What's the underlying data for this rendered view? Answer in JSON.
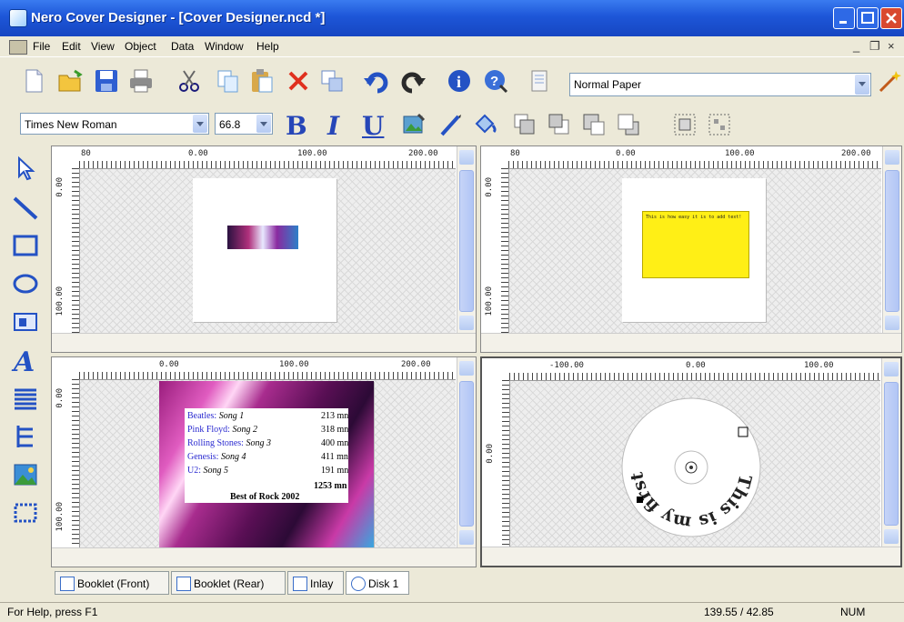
{
  "window": {
    "title": "Nero Cover Designer - [Cover Designer.ncd *]"
  },
  "menu": [
    "File",
    "Edit",
    "View",
    "Object",
    "Data",
    "Window",
    "Help"
  ],
  "mdi_controls": [
    "_",
    "❐",
    "×"
  ],
  "toolbar": {
    "paper_select": "Normal Paper"
  },
  "format_bar": {
    "font": "Times New Roman",
    "font_size": "66.8",
    "bold": "B",
    "italic": "I",
    "underline": "U"
  },
  "panes": {
    "booklet_front": {
      "h_ruler": [
        "80",
        "0.00",
        "100.00",
        "200.00"
      ],
      "v_ruler": [
        "0.00",
        "100.00"
      ]
    },
    "booklet_rear": {
      "h_ruler": [
        "80",
        "0.00",
        "100.00",
        "200.00"
      ],
      "v_ruler": [
        "0.00",
        "100.00"
      ],
      "note": "This is how easy it is to add text!"
    },
    "inlay": {
      "h_ruler": [
        "0.00",
        "100.00",
        "200.00"
      ],
      "v_ruler": [
        "0.00",
        "100.00"
      ],
      "tracks": [
        {
          "artist": "Beatles:",
          "song": "Song 1",
          "time": "213 mn"
        },
        {
          "artist": "Pink Floyd:",
          "song": "Song 2",
          "time": "318 mn"
        },
        {
          "artist": "Rolling Stones:",
          "song": "Song 3",
          "time": "400 mn"
        },
        {
          "artist": "Genesis:",
          "song": "Song 4",
          "time": "411 mn"
        },
        {
          "artist": "U2:",
          "song": "Song 5",
          "time": "191 mn"
        }
      ],
      "total": "1253 mn",
      "footer": "Best of Rock 2002"
    },
    "disk": {
      "h_ruler": [
        "-100.00",
        "0.00",
        "100.00"
      ],
      "v_ruler": [
        "0.00"
      ],
      "label_text": "This is my first label"
    }
  },
  "tabs": [
    {
      "label": "Booklet (Front)"
    },
    {
      "label": "Booklet (Rear)"
    },
    {
      "label": "Inlay"
    },
    {
      "label": "Disk 1"
    }
  ],
  "status": {
    "help": "For Help, press F1",
    "coords": "139.55 / 42.85",
    "num": "NUM"
  }
}
